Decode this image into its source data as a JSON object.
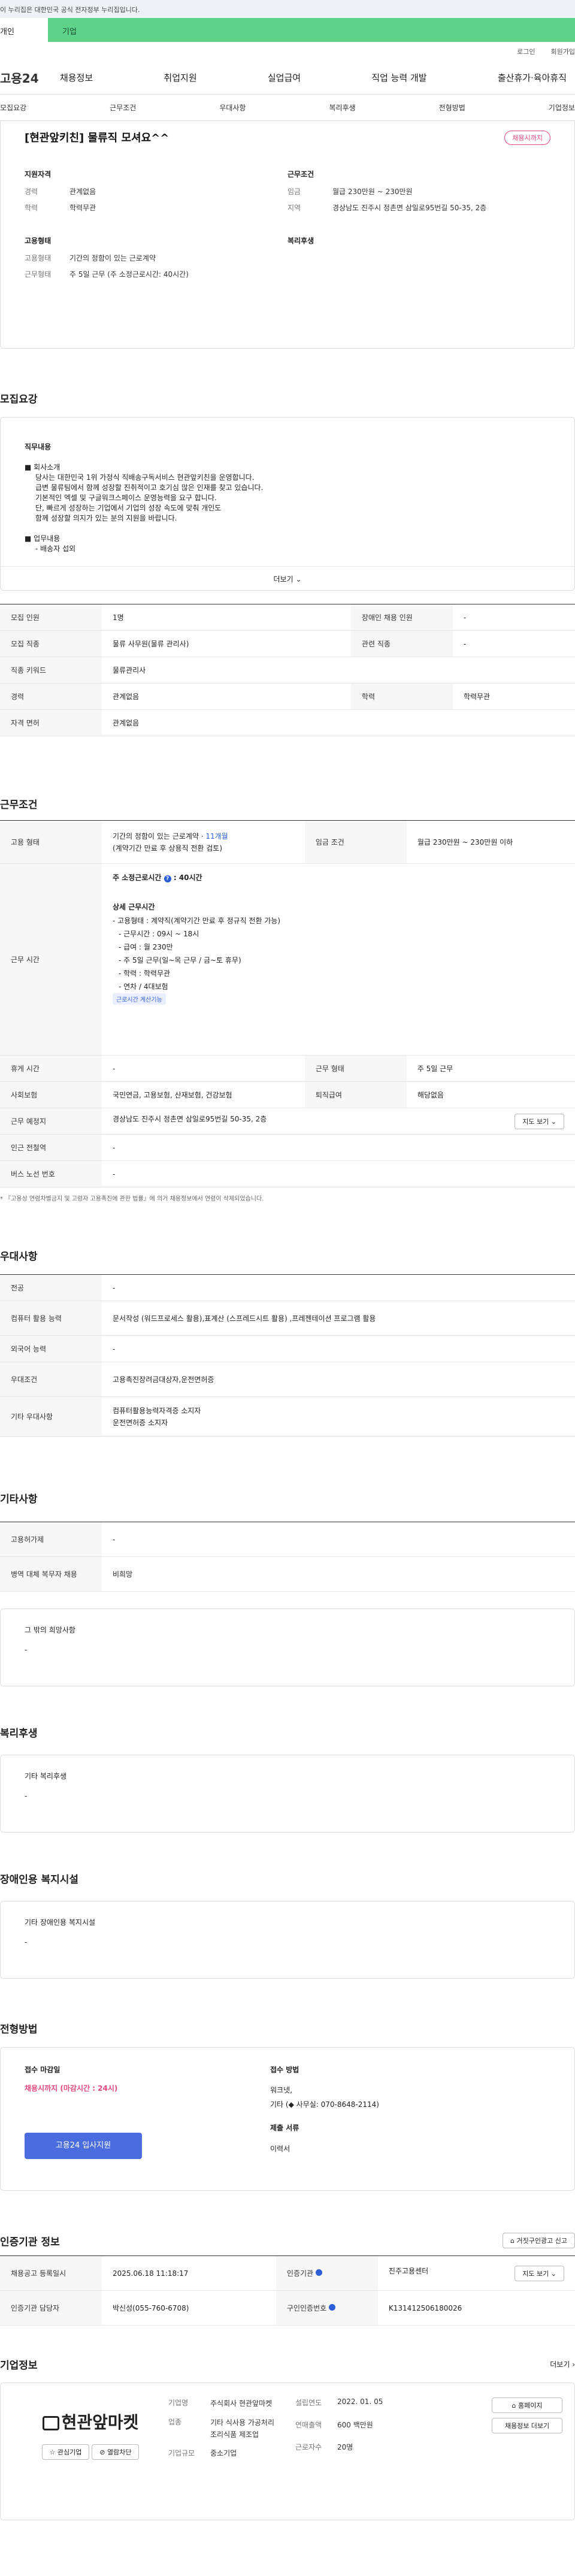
{
  "gov_banner": "이 누리집은 대한민국 공식 전자정부 누리집입니다.",
  "top_tabs": [
    "개인",
    "기업"
  ],
  "util": [
    "로그인",
    "회원가입"
  ],
  "logo": "고용24",
  "gnb": [
    "채용정보",
    "취업지원",
    "실업급여",
    "직업 능력 개발",
    "출산휴가·육아휴직"
  ],
  "anchors": [
    "모집요강",
    "근무조건",
    "우대사항",
    "복리후생",
    "전형방법",
    "기업정보"
  ],
  "summary": {
    "title": "[현관앞키친] 물류직 모셔요^^",
    "badge": "채용시까지",
    "left_title": "지원자격",
    "left": [
      {
        "k": "경력",
        "v": "관계없음"
      },
      {
        "k": "학력",
        "v": "학력무관"
      }
    ],
    "left2_title": "고용형태",
    "left2": [
      {
        "k": "고용형태",
        "v": "기간의 정함이 있는 근로계약"
      },
      {
        "k": "근무형태",
        "v": "주 5일 근무 (주 소정근로시간: 40시간)"
      }
    ],
    "right_title": "근무조건",
    "right": [
      {
        "k": "임금",
        "v": "월급 230만원 ~ 230만원"
      },
      {
        "k": "지역",
        "v": "경상남도 진주시 정촌면 삼일로95번길 50-35, 2층"
      }
    ],
    "right2_title": "복리후생"
  },
  "recruit": {
    "title": "모집요강",
    "desc_title": "직무내용",
    "desc_lines": [
      "■ 회사소개",
      "당사는 대한민국 1위 가정식 직배송구독서비스 현관앞키친을 운영합니다.",
      "급변 물류팀에서 함께 성장할 진취적이고 호기심 많은 인재를 찾고 있습니다.",
      "기본적인 엑셀 및 구글워크스페이스 운영능력을 요구 합니다.",
      "단, 빠르게 성장하는 기업에서 기업의 성장 속도에 맞춰 개인도",
      "함께 성장할 의지가 있는 분의 지원을 바랍니다.",
      "",
      "■ 업무내용",
      "- 배송자 섭외"
    ],
    "more": "더보기",
    "rows": [
      [
        {
          "k": "모집 인원",
          "v": "1명"
        },
        {
          "k": "장애인 채용 인원",
          "v": "-"
        }
      ],
      [
        {
          "k": "모집 직종",
          "v": "물류 사무원(물류 관리사)"
        },
        {
          "k": "관련 직종",
          "v": "-"
        }
      ],
      [
        {
          "k": "직종 키워드",
          "v": "물류관리사"
        }
      ],
      [
        {
          "k": "경력",
          "v": "관계없음"
        },
        {
          "k": "학력",
          "v": "학력무관"
        }
      ],
      [
        {
          "k": "자격 면허",
          "v": "관계없음"
        }
      ]
    ]
  },
  "work": {
    "title": "근무조건",
    "employ_k": "고용 형태",
    "employ_v1": "기간의 정함이 있는 근로계약 · ",
    "employ_months": "11개월",
    "employ_v2": "(계약기간 만료 후 상용직 전환 검토)",
    "wage_k": "임금 조건",
    "wage_v": "월급 230만원 ~ 230만원 이하",
    "hours_k": "근무 시간",
    "hours_main": "주 소정근로시간",
    "hours_val": "40시간",
    "detail_title": "상세 근무시간",
    "detail_lines": [
      "- 고용형태 : 계약직(계약기간 만료 후 정규직 전환 가능)",
      "- 근무시간 : 09시 ~ 18시",
      "- 급여 : 월 230만",
      "- 주 5일 근무(일~목 근무 / 금~토 휴무)",
      "- 학력 : 학력무관",
      "- 연차 / 4대보험"
    ],
    "calc_btn": "근로시간 계산기능",
    "rows": [
      [
        {
          "k": "휴게 시간",
          "v": "-"
        },
        {
          "k": "근무 형태",
          "v": "주 5일 근무"
        }
      ],
      [
        {
          "k": "사회보험",
          "v": "국민연금, 고용보험, 산재보험, 건강보험"
        },
        {
          "k": "퇴직급여",
          "v": "해당없음"
        }
      ]
    ],
    "place_k": "근무 예정지",
    "place_v": "경상남도 진주시 정촌면 삼일로95번길 50-35, 2층",
    "map_btn": "지도 보기",
    "rows2": [
      {
        "k": "인근 전철역",
        "v": "-"
      },
      {
        "k": "버스 노선 번호",
        "v": "-"
      }
    ],
    "note": "* 『고용상 연령차별금지 및 고령자 고용촉진에 관한 법률』에 의거 채용정보에서 연령이 삭제되었습니다."
  },
  "pref": {
    "title": "우대사항",
    "rows": [
      {
        "k": "전공",
        "v": "-"
      },
      {
        "k": "컴퓨터 활용 능력",
        "v": "문서작성 (워드프로세스 활용),표계산 (스프레드시트 활용) ,프레젠테이션 프로그램 활용"
      },
      {
        "k": "외국어 능력",
        "v": "-"
      },
      {
        "k": "우대조건",
        "v": "고용촉진장려금대상자,운전면허증"
      },
      {
        "k": "기타 우대사항",
        "v": "컴퓨터활용능력자격증 소지자",
        "v2": "운전면허증 소지자"
      }
    ]
  },
  "etc": {
    "title": "기타사항",
    "rows": [
      {
        "k": "고용허가제",
        "v": "-"
      },
      {
        "k": "병역 대체 복무자 채용",
        "v": "비희망"
      }
    ],
    "hope_title": "그 밖의 희망사항",
    "hope_v": "-"
  },
  "welfare": {
    "title": "복리후생",
    "box_title": "기타 복리후생",
    "box_v": "-"
  },
  "disabled": {
    "title": "장애인용 복지시설",
    "box_title": "기타 장애인용 복지시설",
    "box_v": "-"
  },
  "select": {
    "title": "전형방법",
    "deadline_t": "접수 마감일",
    "deadline_v": "채용시까지 (마감시간 : 24시)",
    "apply_btn": "고용24 입사지원",
    "method_t": "접수 방법",
    "method_v1": "워크넷,",
    "method_v2": "기타 (◆ 사무실: 070-8648-2114)",
    "docs_t": "제출 서류",
    "docs_v": "이력서"
  },
  "agency": {
    "title": "인증기관 정보",
    "report_btn": "거짓구인광고 신고",
    "rows": [
      [
        {
          "k": "채용공고 등록일시",
          "v": "2025.06.18 11:18:17"
        },
        {
          "k": "인증기관",
          "v": "진주고용센터"
        }
      ],
      [
        {
          "k": "인증기관 담당자",
          "v": "박신성(055-760-6708)"
        },
        {
          "k": "구인인증번호",
          "v": "K131412506180026"
        }
      ]
    ],
    "map_btn": "지도 보기"
  },
  "company": {
    "title": "기업정보",
    "more": "더보기",
    "logo_text": "현관앞마켓",
    "fav_btn": "관심기업",
    "block_btn": "열람차단",
    "rows": [
      {
        "k": "기업명",
        "v": "주식회사 현관앞마켓"
      },
      {
        "k": "업종",
        "v": "기타 식사용 가공처리 조리식품 제조업"
      },
      {
        "k": "기업규모",
        "v": "중소기업"
      }
    ],
    "rows2": [
      {
        "k": "설립연도",
        "v": "2022. 01. 05"
      },
      {
        "k": "연매출액",
        "v": "600 백만원"
      },
      {
        "k": "근로자수",
        "v": "20명"
      }
    ],
    "home_btn": "홈페이지",
    "more_btn": "채용정보 더보기"
  }
}
